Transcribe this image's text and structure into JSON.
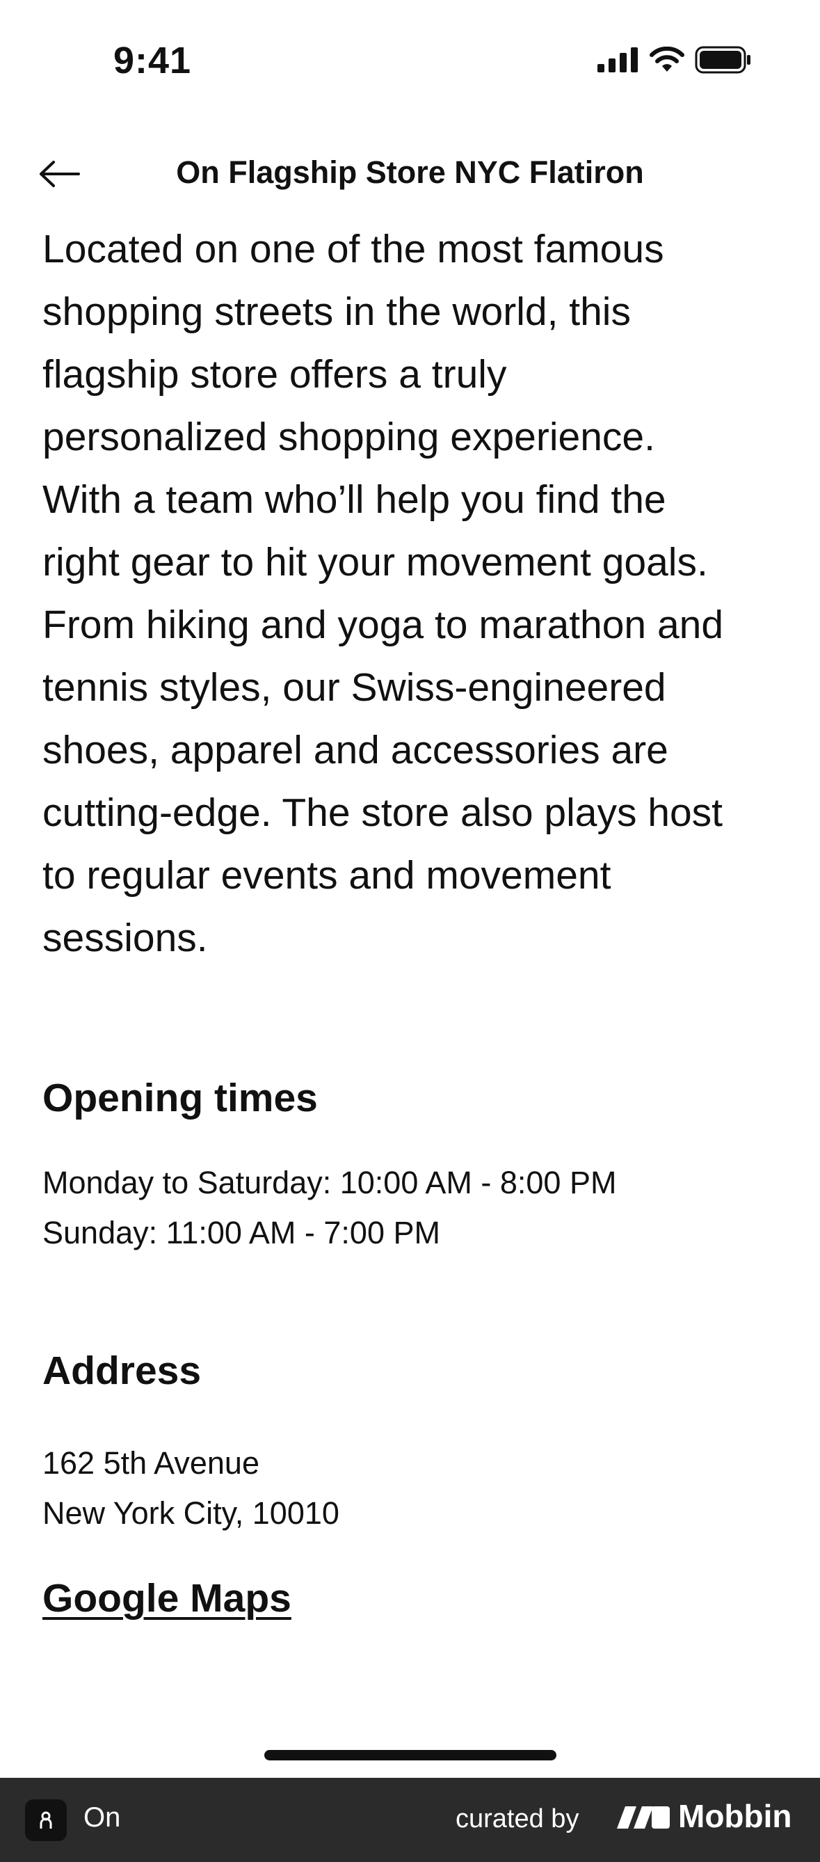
{
  "status_bar": {
    "time": "9:41",
    "icons": [
      "signal-icon",
      "wifi-icon",
      "battery-icon"
    ]
  },
  "nav": {
    "back_icon": "arrow-left-icon",
    "title": "On Flagship Store NYC Flatiron"
  },
  "description": {
    "lines": [
      "Located on one of the most famous",
      "shopping streets in the world, this",
      "flagship store offers a truly",
      "personalized shopping experience.",
      "With a team who’ll help you find the",
      "right gear to hit your movement goals.",
      "From hiking and yoga to marathon and",
      "tennis styles, our Swiss-engineered",
      "shoes, apparel and accessories are",
      "cutting-edge. The store also plays host",
      "to regular events and movement",
      "sessions."
    ]
  },
  "opening_times": {
    "heading": "Opening times",
    "lines": [
      "Monday to Saturday: 10:00 AM - 8:00 PM",
      "Sunday: 11:00 AM - 7:00 PM"
    ]
  },
  "address": {
    "heading": "Address",
    "lines": [
      "162 5th Avenue",
      "New York City, 10010"
    ],
    "maps_link": "Google Maps"
  },
  "footer": {
    "app_name": "On",
    "curated_by": "curated by",
    "brand": "Mobbin",
    "background": "#2b2b2b"
  }
}
